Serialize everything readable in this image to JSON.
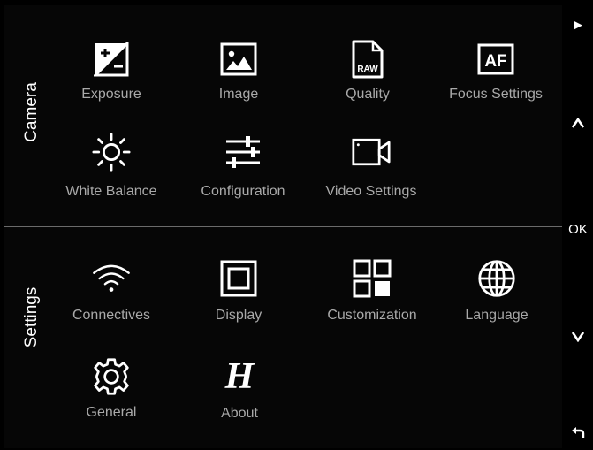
{
  "camera": {
    "section_label": "Camera",
    "items": [
      {
        "label": "Exposure",
        "icon": "exposure-icon"
      },
      {
        "label": "Image",
        "icon": "image-icon"
      },
      {
        "label": "Quality",
        "icon": "raw-file-icon",
        "badge": "RAW"
      },
      {
        "label": "Focus Settings",
        "icon": "af-icon",
        "badge": "AF"
      },
      {
        "label": "White Balance",
        "icon": "sun-icon"
      },
      {
        "label": "Configuration",
        "icon": "sliders-icon"
      },
      {
        "label": "Video Settings",
        "icon": "video-camera-icon"
      }
    ]
  },
  "settings": {
    "section_label": "Settings",
    "items": [
      {
        "label": "Connectives",
        "icon": "wifi-icon"
      },
      {
        "label": "Display",
        "icon": "display-icon"
      },
      {
        "label": "Customization",
        "icon": "grid-icon"
      },
      {
        "label": "Language",
        "icon": "globe-icon"
      },
      {
        "label": "General",
        "icon": "gear-icon"
      },
      {
        "label": "About",
        "icon": "hasselblad-h-icon",
        "glyph": "H"
      }
    ]
  },
  "rail": {
    "play": "▶",
    "up": "▲",
    "ok": "OK",
    "down": "▼",
    "back": "↩"
  },
  "colors": {
    "background": "#060606",
    "label": "#a9a9a9",
    "icon": "#ffffff",
    "divider": "#6a6a6a"
  }
}
